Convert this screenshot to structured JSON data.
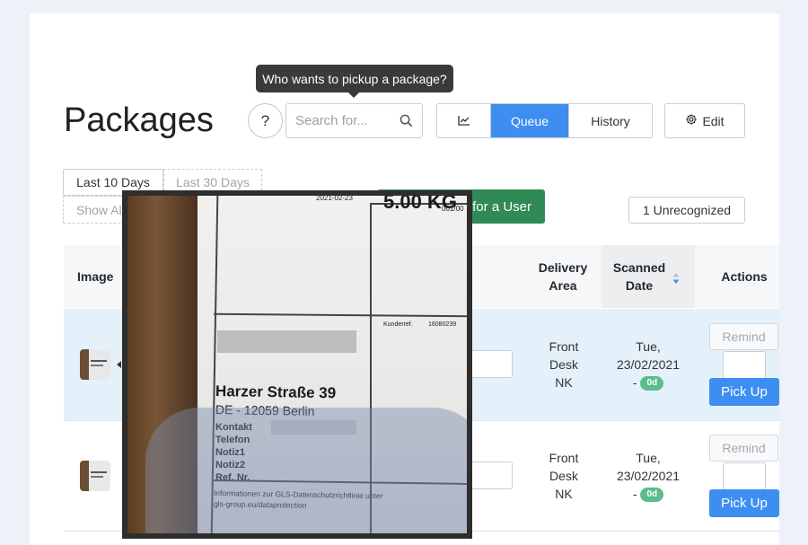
{
  "page": {
    "title": "Packages"
  },
  "tooltip": {
    "text": "Who wants to pickup a package?"
  },
  "help": {
    "label": "?"
  },
  "search": {
    "placeholder": "Search for..."
  },
  "view_tabs": [
    {
      "label": "",
      "icon": "line-chart-icon"
    },
    {
      "label": "Queue",
      "active": true
    },
    {
      "label": "History"
    }
  ],
  "edit": {
    "label": "Edit",
    "icon": "gear-icon"
  },
  "filters": {
    "last10": "Last 10 Days",
    "last30": "Last 30 Days",
    "showall": "Show Al"
  },
  "green_button": {
    "label": "for a User"
  },
  "unrecognized": {
    "label": "1 Unrecognized"
  },
  "table": {
    "headers": {
      "image": "Image",
      "delivery_l1": "Delivery",
      "delivery_l2": "Area",
      "scanned_l1": "Scanned",
      "scanned_l2": "Date",
      "actions": "Actions"
    },
    "rows": [
      {
        "area_l1": "Front",
        "area_l2": "Desk",
        "area_l3": "NK",
        "date_l1": "Tue,",
        "date_l2": "23/02/2021",
        "date_dash": "-",
        "age": "0d",
        "remind": "Remind",
        "pickup": "Pick Up"
      },
      {
        "area_l1": "Front",
        "area_l2": "Desk",
        "area_l3": "NK",
        "date_l1": "Tue,",
        "date_l2": "23/02/2021",
        "date_dash": "-",
        "age": "0d",
        "remind": "Remind",
        "pickup": "Pick Up"
      }
    ]
  },
  "preview": {
    "weight": "5.00 KG",
    "date_fragment": "2021-02-23",
    "code_fragment": "001/00",
    "kundenref": "Kunderref.",
    "kundenref_no": "16080239",
    "street": "Harzer Straße 39",
    "city": "DE - 12059 Berlin",
    "kontakt": "Kontakt",
    "telefon": "Telefon",
    "notiz1": "Notiz1",
    "notiz2": "Notiz2",
    "refnr": "Ref. Nr.",
    "privacy_l1": "Informationen zur GLS-Datenschutzrichtlinie unter",
    "privacy_l2": "gls-group.eu/dataprotection"
  },
  "colors": {
    "primary": "#3d8ef0",
    "success": "#2f8a58",
    "badge": "#5bbd8b",
    "row_highlight": "#e4f1fb"
  }
}
